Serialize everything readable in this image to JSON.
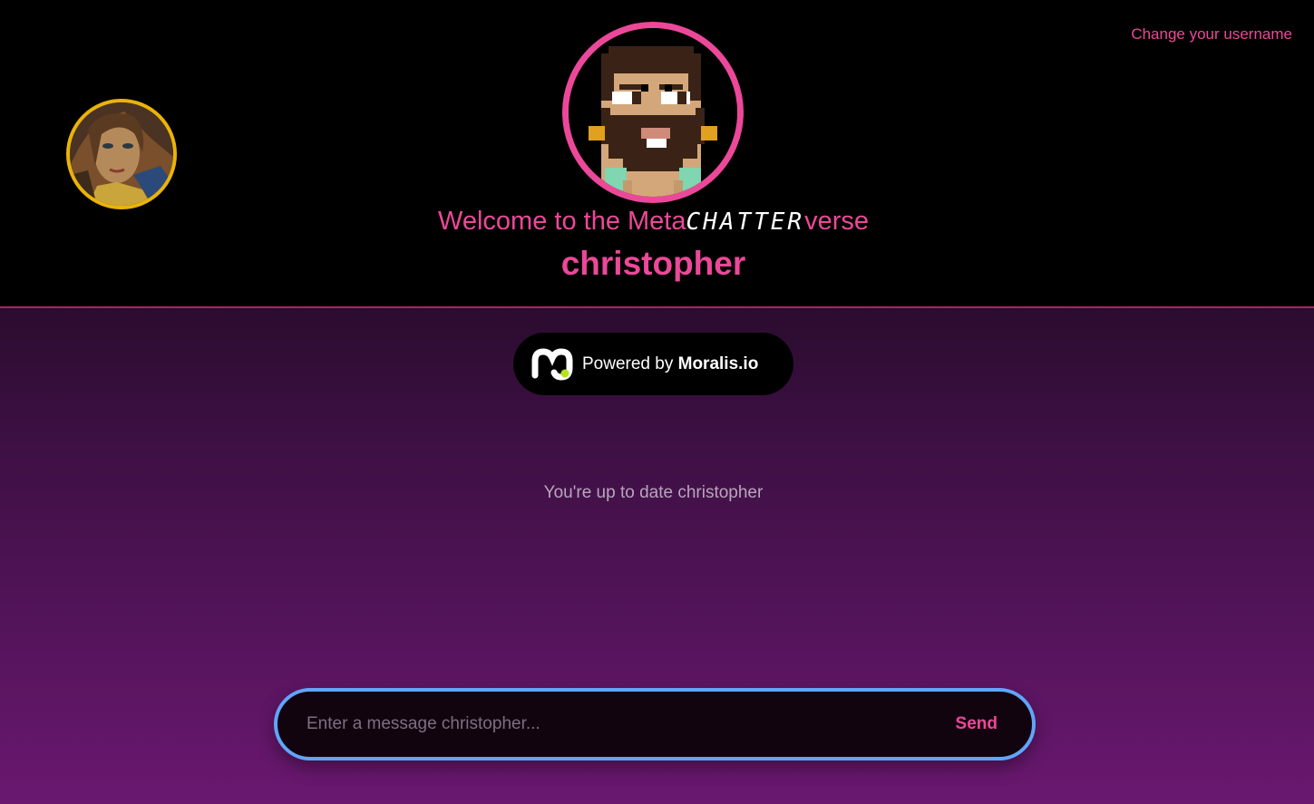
{
  "header": {
    "change_username_label": "Change your username",
    "welcome_prefix": "Welcome to the Meta",
    "welcome_brand": "CHATTER",
    "welcome_suffix": "verse",
    "username": "christopher"
  },
  "powered_by": {
    "prefix": "Powered by ",
    "brand": "Moralis.io",
    "logo_icon": "moralis-logo-icon"
  },
  "chat": {
    "status_text": "You're up to date christopher"
  },
  "composer": {
    "placeholder": "Enter a message christopher...",
    "send_label": "Send"
  },
  "colors": {
    "accent": "#ec4899",
    "avatar_ring_main": "#ec4899",
    "avatar_ring_side": "#eab308",
    "input_border": "#60a5fa",
    "header_bg": "#000000"
  }
}
